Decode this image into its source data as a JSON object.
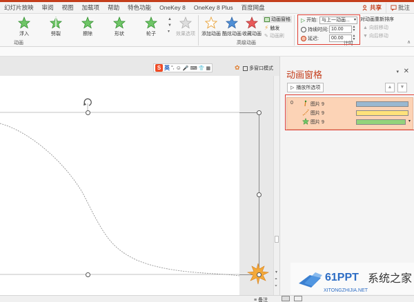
{
  "menu": {
    "items": [
      "幻灯片放映",
      "审阅",
      "视图",
      "加载项",
      "帮助",
      "特色功能",
      "OneKey 8",
      "OneKey 8 Plus",
      "百度网盘"
    ],
    "share": "共享",
    "comment": "批注"
  },
  "ribbon": {
    "effects": [
      "浮入",
      "劈裂",
      "擦除",
      "形状",
      "轮子"
    ],
    "effect_options": "效果选项",
    "group_animation": "动画",
    "add_animation": "添加动画",
    "animation_brush": "酷炫动画",
    "collect_animation": "收藏动画",
    "animation_pane": "动画窗格",
    "trigger": "触发",
    "animation_painter": "动画刷",
    "group_advanced": "高级动画",
    "start_label": "开始:",
    "start_value": "与上一动画...",
    "duration_label": "持续时间:",
    "duration_value": "10.00",
    "delay_label": "延迟:",
    "delay_value": "00.00",
    "reorder_title": "对动画重新排序",
    "move_earlier": "向前移动",
    "move_later": "向后移动",
    "group_timing": "计时",
    "accent": "#c43e1c",
    "highlight_border": "#e03c31"
  },
  "editor": {
    "sogou_label": "英",
    "multi_window": "多窗口模式"
  },
  "pane": {
    "title": "动画窗格",
    "play_from": "播放所选项",
    "rows": [
      {
        "num": "0",
        "name": "图片 9",
        "icon": "motion-path-icon",
        "bar_color": "#9ab8d0"
      },
      {
        "num": "",
        "name": "图片 9",
        "icon": "fly-path-icon",
        "bar_color": "#ffe27a"
      },
      {
        "num": "",
        "name": "图片 9",
        "icon": "star-effect-icon",
        "bar_color": "#93d37b"
      }
    ],
    "list_bg": "#fcd3b6"
  },
  "status": {
    "notes": "备注"
  },
  "watermark": {
    "brand": "61PPT",
    "url": "XITONGZHIJIA.NET"
  }
}
